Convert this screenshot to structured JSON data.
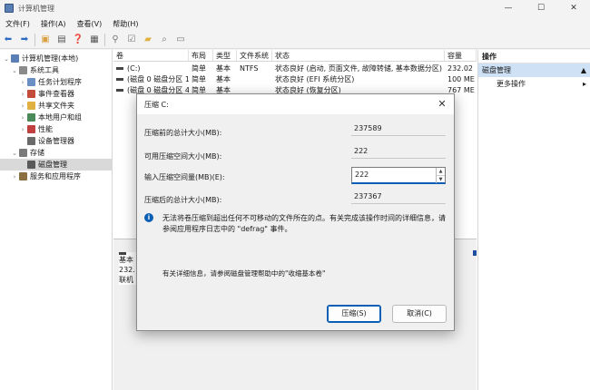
{
  "window": {
    "title": "计算机管理",
    "minimize": "—",
    "maximize": "☐",
    "close": "✕"
  },
  "menu": [
    "文件(F)",
    "操作(A)",
    "查看(V)",
    "帮助(H)"
  ],
  "tree": {
    "items": [
      {
        "label": "计算机管理(本地)",
        "indent": 0,
        "chev": "⌄",
        "icon_color": "#5a7fb5",
        "icon": "computer-icon"
      },
      {
        "label": "系统工具",
        "indent": 1,
        "chev": "⌄",
        "icon_color": "#8a8a8a",
        "icon": "tools-icon"
      },
      {
        "label": "任务计划程序",
        "indent": 2,
        "chev": "›",
        "icon_color": "#6a8fc4",
        "icon": "clock-icon"
      },
      {
        "label": "事件查看器",
        "indent": 2,
        "chev": "›",
        "icon_color": "#c44a3a",
        "icon": "event-icon"
      },
      {
        "label": "共享文件夹",
        "indent": 2,
        "chev": "›",
        "icon_color": "#e0b040",
        "icon": "folder-icon"
      },
      {
        "label": "本地用户和组",
        "indent": 2,
        "chev": "›",
        "icon_color": "#4a8a5a",
        "icon": "users-icon"
      },
      {
        "label": "性能",
        "indent": 2,
        "chev": "›",
        "icon_color": "#c04040",
        "icon": "performance-icon"
      },
      {
        "label": "设备管理器",
        "indent": 2,
        "chev": "",
        "icon_color": "#6a6a6a",
        "icon": "device-icon"
      },
      {
        "label": "存储",
        "indent": 1,
        "chev": "⌄",
        "icon_color": "#7a7a7a",
        "icon": "storage-icon"
      },
      {
        "label": "磁盘管理",
        "indent": 2,
        "chev": "",
        "icon_color": "#5a5a5a",
        "icon": "disk-icon",
        "selected": true
      },
      {
        "label": "服务和应用程序",
        "indent": 1,
        "chev": "›",
        "icon_color": "#8a7040",
        "icon": "services-icon"
      }
    ]
  },
  "volumes": {
    "headers": [
      "卷",
      "布局",
      "类型",
      "文件系统",
      "状态",
      "容量"
    ],
    "rows": [
      {
        "vol": "(C:)",
        "layout": "简单",
        "type": "基本",
        "fs": "NTFS",
        "status": "状态良好 (启动, 页面文件, 故障转储, 基本数据分区)",
        "cap": "232.02"
      },
      {
        "vol": "(磁盘 0 磁盘分区 1)",
        "layout": "简单",
        "type": "基本",
        "fs": "",
        "status": "状态良好 (EFI 系统分区)",
        "cap": "100 ME"
      },
      {
        "vol": "(磁盘 0 磁盘分区 4)",
        "layout": "简单",
        "type": "基本",
        "fs": "",
        "status": "状态良好 (恢复分区)",
        "cap": "767 ME"
      }
    ]
  },
  "disk_map": {
    "lines": [
      "基本",
      "232.",
      "联机"
    ]
  },
  "actions": {
    "header": "操作",
    "section": "磁盘管理",
    "section_arrow": "▲",
    "more": "更多操作",
    "more_arrow": "▸"
  },
  "dialog": {
    "title": "压缩 C:",
    "close": "✕",
    "total_before_label": "压缩前的总计大小(MB):",
    "total_before_value": "237589",
    "available_label": "可用压缩空间大小(MB):",
    "available_value": "222",
    "input_label": "输入压缩空间量(MB)(E):",
    "input_value": "222",
    "total_after_label": "压缩后的总计大小(MB):",
    "total_after_value": "237367",
    "info_text": "无法将卷压缩到超出任何不可移动的文件所在的点。有关完成该操作时间的详细信息，请参阅应用程序日志中的 \"defrag\" 事件。",
    "help_text": "有关详细信息，请参阅磁盘管理帮助中的\"收缩基本卷\"",
    "ok_button": "压缩(S)",
    "cancel_button": "取消(C)"
  },
  "colors": {
    "accent": "#0a5fb4",
    "selected_tree": "#d9d9d9",
    "actions_highlight": "#cfe1f5"
  }
}
